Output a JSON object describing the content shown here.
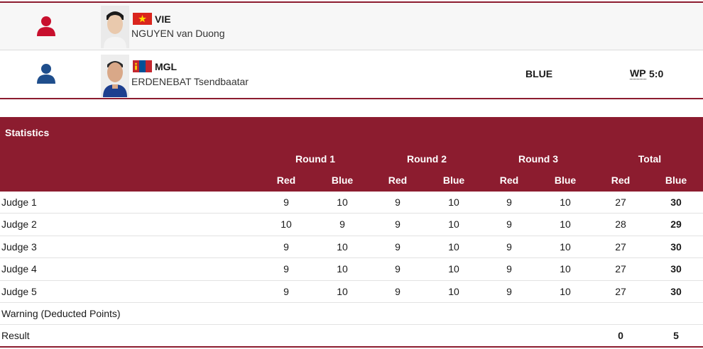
{
  "athletes": {
    "red": {
      "noc": "VIE",
      "name": "NGUYEN van Duong",
      "corner_color": "#c8102e",
      "flag": "vietnam-flag-icon"
    },
    "blue": {
      "noc": "MGL",
      "name": "ERDENEBAT Tsendbaatar",
      "corner_color": "#1f4e8c",
      "flag": "mongolia-flag-icon",
      "winner_corner": "BLUE",
      "win_type": "WP",
      "win_score": "5:0"
    }
  },
  "statistics": {
    "title": "Statistics",
    "rounds": [
      "Round 1",
      "Round 2",
      "Round 3",
      "Total"
    ],
    "sub_headers": [
      "Red",
      "Blue",
      "Red",
      "Blue",
      "Red",
      "Blue",
      "Red",
      "Blue"
    ],
    "rows": [
      {
        "label": "Judge 1",
        "cells": [
          "9",
          "10",
          "9",
          "10",
          "9",
          "10",
          "27",
          "30"
        ]
      },
      {
        "label": "Judge 2",
        "cells": [
          "10",
          "9",
          "9",
          "10",
          "9",
          "10",
          "28",
          "29"
        ]
      },
      {
        "label": "Judge 3",
        "cells": [
          "9",
          "10",
          "9",
          "10",
          "9",
          "10",
          "27",
          "30"
        ]
      },
      {
        "label": "Judge 4",
        "cells": [
          "9",
          "10",
          "9",
          "10",
          "9",
          "10",
          "27",
          "30"
        ]
      },
      {
        "label": "Judge 5",
        "cells": [
          "9",
          "10",
          "9",
          "10",
          "9",
          "10",
          "27",
          "30"
        ]
      },
      {
        "label": "Warning (Deducted Points)",
        "cells": [
          "",
          "",
          "",
          "",
          "",
          "",
          "",
          ""
        ]
      },
      {
        "label": "Result",
        "cells": [
          "",
          "",
          "",
          "",
          "",
          "",
          "0",
          "5"
        ]
      }
    ],
    "header_color": "#8c1c2f"
  }
}
